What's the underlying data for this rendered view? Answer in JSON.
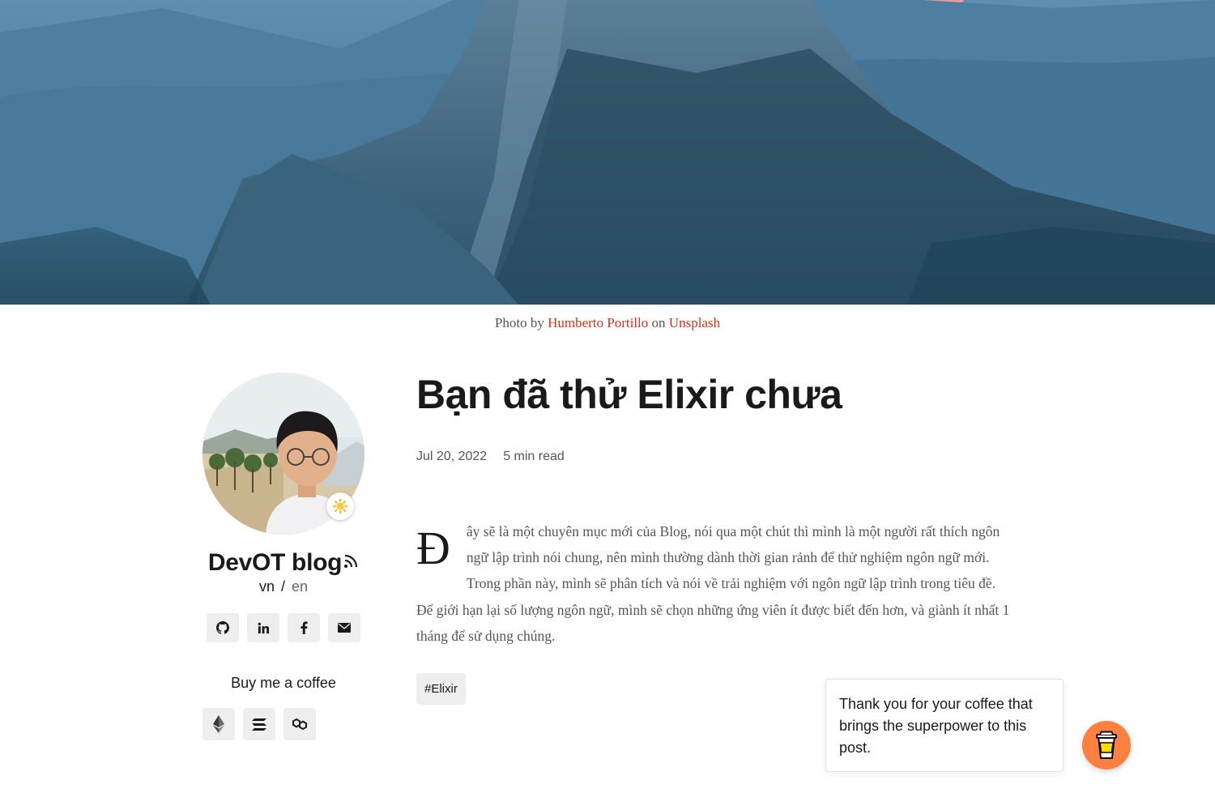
{
  "hero": {
    "caption_prefix": "Photo by",
    "photographer": "Humberto Portillo",
    "caption_middle": "on",
    "source": "Unsplash"
  },
  "sidebar": {
    "blog_name": "DevOT blog",
    "lang_vn": "vn",
    "lang_sep": "/",
    "lang_en": "en",
    "social_icons": [
      "github-icon",
      "linkedin-icon",
      "facebook-icon",
      "email-icon"
    ],
    "coffee_label": "Buy me a coffee",
    "crypto_icons": [
      "ethereum-icon",
      "solana-icon",
      "polygon-icon"
    ],
    "theme_icon": "sun-icon"
  },
  "article": {
    "title": "Bạn đã thử Elixir chưa",
    "date": "Jul 20, 2022",
    "read_time": "5 min read",
    "dropcap": "Đ",
    "body": "ây sẽ là một chuyên mục mới của Blog, nói qua một chút thì mình là một người rất thích ngôn ngữ lập trình nói chung, nên mình thường dành thời gian rảnh để thử nghiệm ngôn ngữ mới. Trong phần này, mình sẽ phân tích và nói về trải nghiệm với ngôn ngữ lập trình trong tiêu đề. Để giới hạn lại số lượng ngôn ngữ, mình sẽ chọn những ứng viên ít được biết đến hơn, và giành ít nhất 1 tháng để sử dụng chúng.",
    "tag": "#Elixir"
  },
  "coffee_widget": {
    "message": "Thank you for your coffee that brings the superpower to this post.",
    "button_icon": "coffee-cup-icon",
    "accent": "#ff813f"
  },
  "colors": {
    "link": "#d1341f",
    "chip_bg": "#eeeeee"
  }
}
